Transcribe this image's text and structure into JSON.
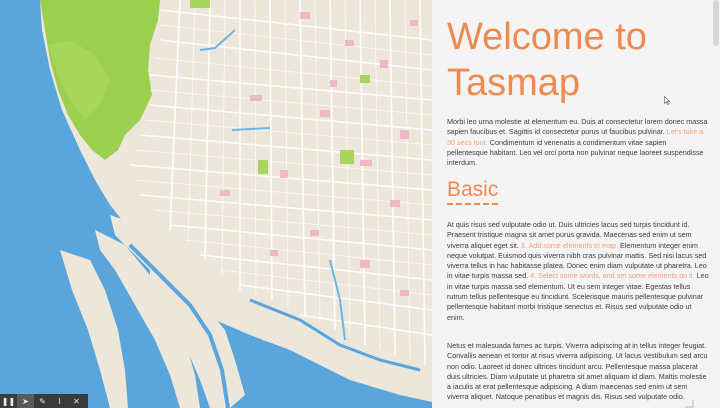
{
  "panel": {
    "title": "Welcome to Tasmap",
    "intro": {
      "text1": "Morbi leo urna molestie at elementum eu. Duis at consectetur lorem donec massa sapien faucibus et. Sagittis id consectetur purus ut faucibus pulvinar. ",
      "link": "Let's take a 30 secs tour.",
      "text2": " Condimentum id venenatis a condimentum vitae sapien pellentesque habitant. Leo vel orci porta non pulvinar neque laoreet suspendisse interdum."
    },
    "heading": "Basic",
    "basic": {
      "text1": "At quis risus sed vulputate odio ut. Duis ultricies lacus sed turpis tincidunt id. Praesent tristique magna sit amet purus gravida. Maecenas sed enim ut sem viverra aliquet eget sit. ",
      "link1": "3. Add some elements to map.",
      "text2": " Elementum integer enim neque volutpat. Euismod quis viverra nibh cras pulvinar mattis. Sed nisi lacus sed viverra tellus in hac habitasse platea. Donec enim diam vulputate ut pharetra. Leo in vitae turpis massa sed. ",
      "link2": "4. Select some words, and set some elements on it.",
      "text3": " Leo in vitae turpis massa sed elementum. Ut eu sem integer vitae. Egestas tellus rutrum tellus pellentesque eu tincidunt. Scelerisque mauris pellentesque pulvinar pellentesque habitant morbi tristique senectus et. Risus sed vulputate odio ut enim."
    },
    "netus": "Netus et malesuada fames ac turpis. Viverra adipiscing at in tellus integer feugiat. Convallis aenean et tortor at risus viverra adipiscing. Ut lacus vestibulum sed arcu non odio. Laoreet id donec ultrices tincidunt arcu. Pellentesque massa placerat duis ultricies. Diam vulputate ut pharetra sit amet aliquam id diam. Mattis molestie a iaculis at erat pellentesque adipiscing. A diam maecenas sed enim ut sem viverra aliquet. Natoque penatibus et magnis dis. Risus sed vulputate odio."
  },
  "toolbar": {
    "items": [
      {
        "icon": "pause-icon",
        "glyph": "❚❚"
      },
      {
        "icon": "pointer-icon",
        "glyph": "➤"
      },
      {
        "icon": "pencil-icon",
        "glyph": "✎"
      },
      {
        "icon": "brush-icon",
        "glyph": "⌇"
      },
      {
        "icon": "close-icon",
        "glyph": "✕"
      }
    ]
  },
  "colors": {
    "sea": "#5aa6dc",
    "land": "#ece7da",
    "park": "#9bcf4e",
    "accent": "#ee8a4f",
    "link": "#f4a272"
  }
}
